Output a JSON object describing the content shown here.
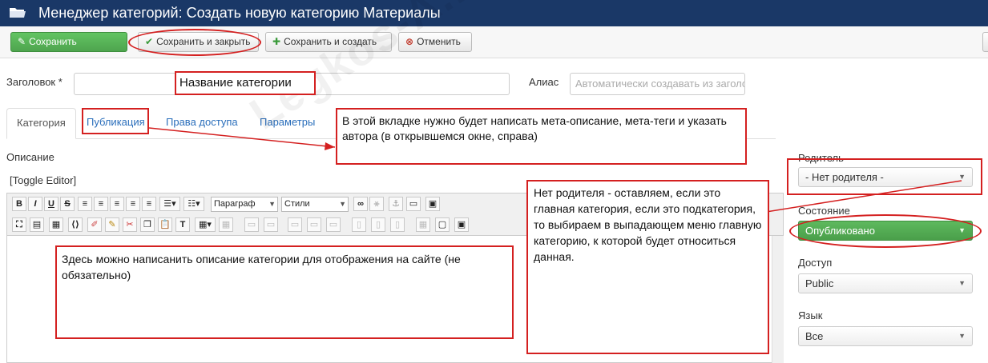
{
  "header": {
    "title": "Менеджер категорий: Создать новую категорию Материалы",
    "icon": "folder-icon"
  },
  "toolbar": {
    "save_label": "Сохранить",
    "save_close_label": "Сохранить и закрыть",
    "save_new_label": "Сохранить и создать",
    "cancel_label": "Отменить"
  },
  "form": {
    "title_label": "Заголовок *",
    "title_value": "",
    "alias_label": "Алиас",
    "alias_placeholder": "Автоматически создавать из заголовка"
  },
  "tabs": [
    {
      "label": "Категория"
    },
    {
      "label": "Публикация"
    },
    {
      "label": "Права доступа"
    },
    {
      "label": "Параметры"
    }
  ],
  "editor": {
    "description_label": "Описание",
    "toggle_label": "[Toggle Editor]",
    "format_select": "Параграф",
    "styles_select": "Стили",
    "buttons_row1": [
      "B",
      "I",
      "U",
      "S"
    ]
  },
  "sidebar": {
    "parent_label": "Родитель",
    "parent_value": "- Нет родителя -",
    "state_label": "Состояние",
    "state_value": "Опубликовано",
    "access_label": "Доступ",
    "access_value": "Public",
    "language_label": "Язык",
    "language_value": "Все"
  },
  "annotations": {
    "title_note": "Название категории",
    "tab_note": "В этой вкладке нужно будет написать мета-описание, мета-теги и указать автора (в открывшемся окне, справа)",
    "description_note": "Здесь можно написанить описание категории для отображения на сайте (не обязательно)",
    "parent_note": "Нет родителя - оставляем, если это главная категория, если это подкатегория, то выбираем в выпадающем меню главную категорию, к которой будет относиться данная."
  },
  "watermark": "Legkos-A.ru",
  "colors": {
    "header_bg": "#1a3867",
    "save_button": "#5cb85c",
    "published_select": "#4ea44e",
    "annotation_red": "#d42020",
    "link_blue": "#2a6ebb"
  }
}
